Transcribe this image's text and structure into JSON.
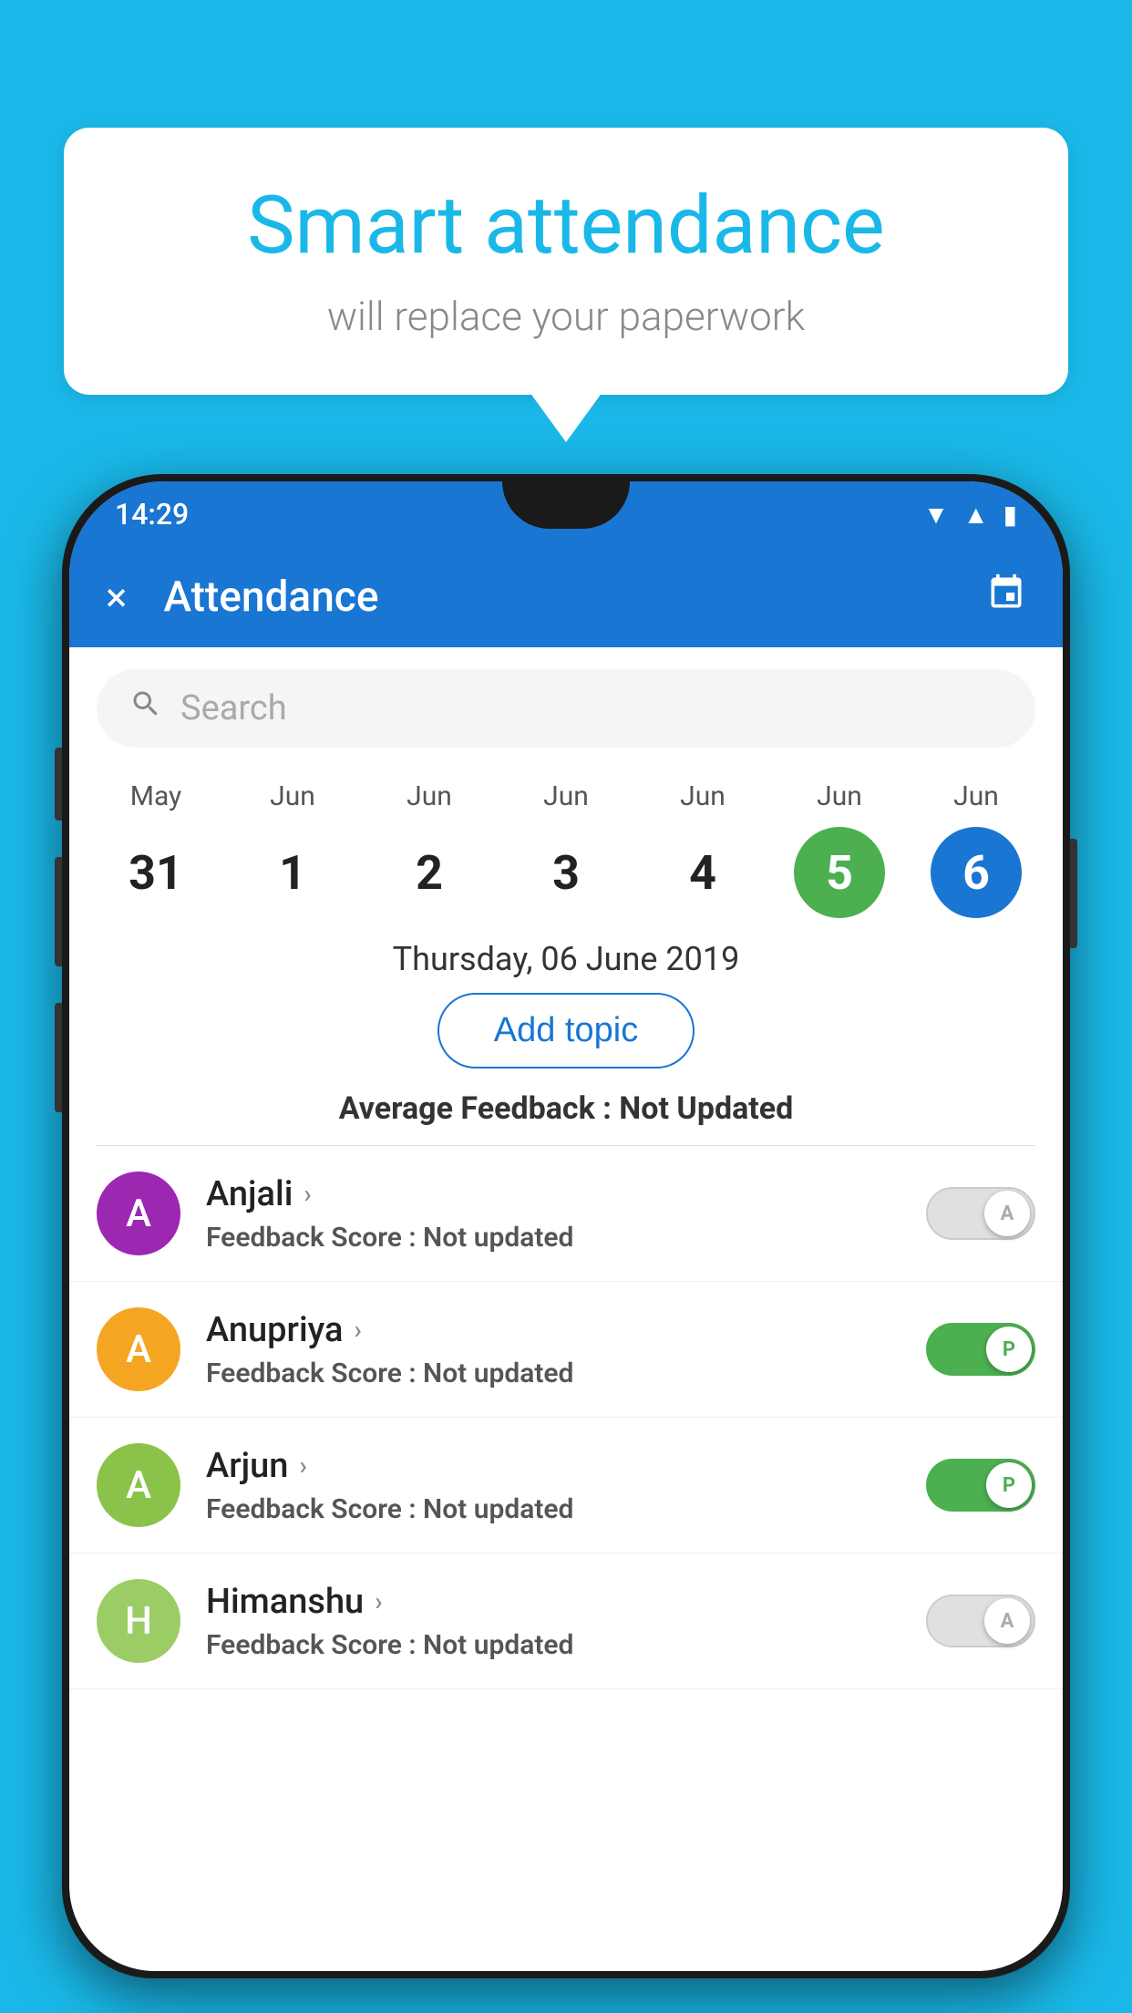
{
  "background_color": "#1ab8e8",
  "bubble": {
    "title": "Smart attendance",
    "subtitle": "will replace your paperwork"
  },
  "app_bar": {
    "title": "Attendance",
    "close_label": "×",
    "calendar_icon": "📅"
  },
  "status_bar": {
    "time": "14:29",
    "wifi_icon": "wifi",
    "signal_icon": "signal",
    "battery_icon": "battery"
  },
  "search": {
    "placeholder": "Search"
  },
  "calendar": {
    "days": [
      {
        "month": "May",
        "date": "31",
        "state": "normal"
      },
      {
        "month": "Jun",
        "date": "1",
        "state": "normal"
      },
      {
        "month": "Jun",
        "date": "2",
        "state": "normal"
      },
      {
        "month": "Jun",
        "date": "3",
        "state": "normal"
      },
      {
        "month": "Jun",
        "date": "4",
        "state": "normal"
      },
      {
        "month": "Jun",
        "date": "5",
        "state": "today"
      },
      {
        "month": "Jun",
        "date": "6",
        "state": "selected"
      }
    ],
    "selected_date_label": "Thursday, 06 June 2019"
  },
  "add_topic_label": "Add topic",
  "average_feedback": {
    "label": "Average Feedback : ",
    "value": "Not Updated"
  },
  "students": [
    {
      "name": "Anjali",
      "avatar_letter": "A",
      "avatar_color": "#9c27b0",
      "feedback_label": "Feedback Score : ",
      "feedback_value": "Not updated",
      "toggle": "off",
      "toggle_label": "A"
    },
    {
      "name": "Anupriya",
      "avatar_letter": "A",
      "avatar_color": "#f4a623",
      "feedback_label": "Feedback Score : ",
      "feedback_value": "Not updated",
      "toggle": "on",
      "toggle_label": "P"
    },
    {
      "name": "Arjun",
      "avatar_letter": "A",
      "avatar_color": "#8bc34a",
      "feedback_label": "Feedback Score : ",
      "feedback_value": "Not updated",
      "toggle": "on",
      "toggle_label": "P"
    },
    {
      "name": "Himanshu",
      "avatar_letter": "H",
      "avatar_color": "#9ccc65",
      "feedback_label": "Feedback Score : ",
      "feedback_value": "Not updated",
      "toggle": "off",
      "toggle_label": "A"
    }
  ]
}
